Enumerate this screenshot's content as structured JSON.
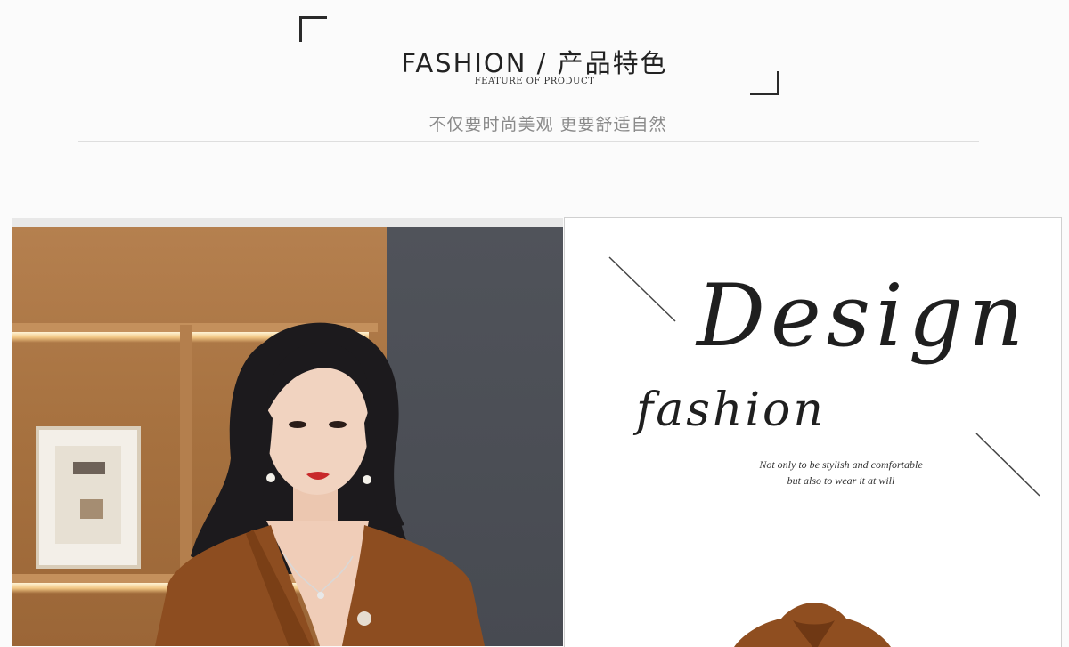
{
  "header": {
    "title": "FASHION / 产品特色",
    "subtitle_en": "FEATURE OF PRODUCT",
    "tagline_cn": "不仅要时尚美观 更要舒适自然"
  },
  "design_panel": {
    "headline": "Design",
    "subheadline": "fashion",
    "note_line1": "Not only to be stylish and comfortable",
    "note_line2": "but also to wear it at will"
  },
  "colors": {
    "accent_text": "#222222",
    "muted_text": "#8a8a8a",
    "coat_brown": "#8f4e20",
    "wall_gray": "#4b4e55"
  }
}
